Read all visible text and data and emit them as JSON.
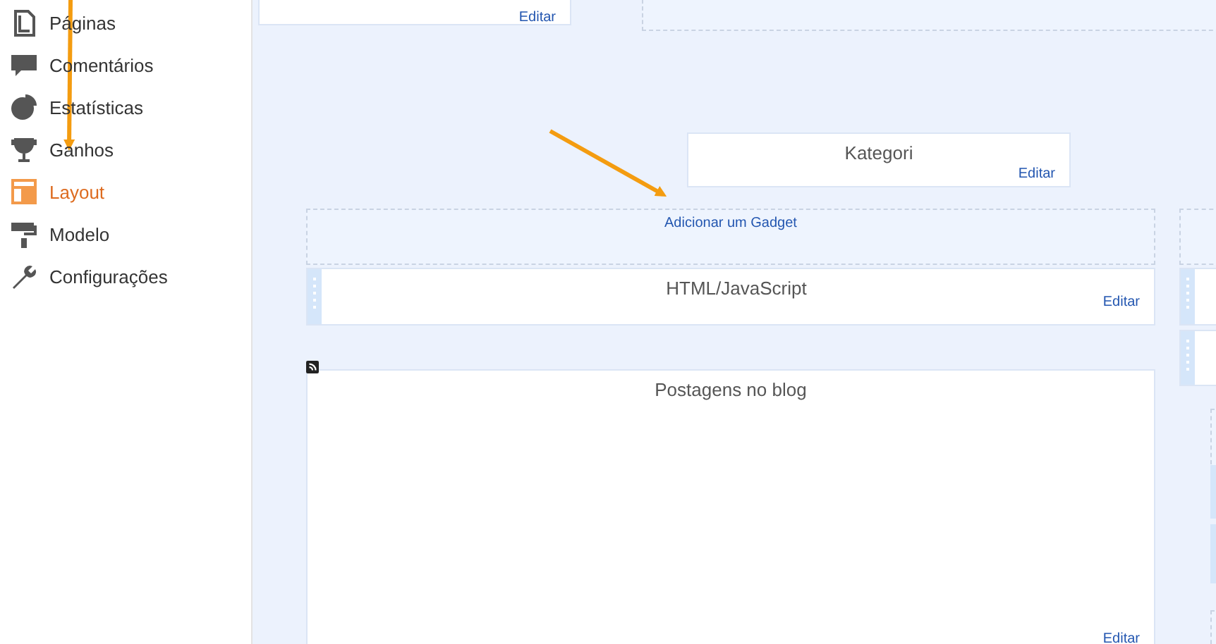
{
  "sidebar": {
    "items": [
      {
        "label": "Páginas",
        "selected": false
      },
      {
        "label": "Comentários",
        "selected": false
      },
      {
        "label": "Estatísticas",
        "selected": false
      },
      {
        "label": "Ganhos",
        "selected": false
      },
      {
        "label": "Layout",
        "selected": true
      },
      {
        "label": "Modelo",
        "selected": false
      },
      {
        "label": "Configurações",
        "selected": false
      }
    ]
  },
  "layout": {
    "top_gadget": {
      "link": "Editar"
    },
    "kategori_gadget": {
      "title": "Kategori",
      "link": "Editar"
    },
    "add_gadget": {
      "link": "Adicionar um Gadget"
    },
    "gadgets": [
      {
        "title": "HTML/JavaScript",
        "link": "Editar",
        "kind": "short"
      },
      {
        "title": "Postagens no blog",
        "link": "Editar",
        "kind": "tall"
      }
    ]
  }
}
